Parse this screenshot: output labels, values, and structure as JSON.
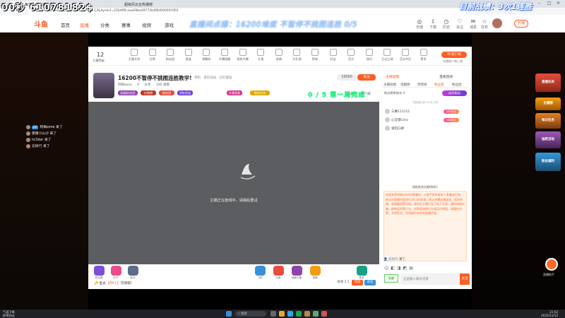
{
  "overlay": {
    "left_counter": "00秒 61078182$",
    "right_stats": "目前战绩：3次1连胜",
    "marquee": "直播间点播：16200难度 不暂停不挑图连胜 0/5",
    "score": "0 / 5 第一局完成"
  },
  "browser": {
    "tab_active": "斗鱼 - 每个人的直播平台",
    "tab_second": "超级风云台热播榜",
    "url": "https://www.douyu.com/topic/zhx?rid=12&dyshid=22b4ff8-aaa09ba49772b4f8d69000l1f01"
  },
  "site": {
    "logo": "斗鱼",
    "nav": [
      "首页",
      "直播",
      "分类",
      "赛事",
      "视频",
      "游戏"
    ],
    "icons": [
      {
        "icon": "globe-icon",
        "label": "无缝"
      },
      {
        "icon": "download-icon",
        "label": "下载"
      },
      {
        "icon": "history-icon",
        "label": "历史"
      },
      {
        "icon": "heart-icon",
        "label": "关注"
      },
      {
        "icon": "mail-icon",
        "label": "消息"
      },
      {
        "icon": "star-icon",
        "label": "任务"
      }
    ],
    "start_live": "开播"
  },
  "category_bar": {
    "level": "12",
    "level_sub": "主播等级",
    "items": [
      "主播开关",
      "月榜",
      "粉丝团",
      "贵族",
      "弹幕机",
      "开播提醒",
      "贵族专属",
      "礼物",
      "表情",
      "大礼物",
      "更新",
      "好友",
      "官方",
      "快讯",
      "互动工具",
      "活动专区",
      "更多"
    ],
    "pc_button": "PC客户端",
    "pc_sub": "去播客户端上播"
  },
  "anchor": {
    "title": "16200不暂停不挑图连胜教学!",
    "tags": "单机 · 冒险竞技 · 记忆图鉴",
    "name": "阿梅zone",
    "heat": "9",
    "sharing": "分享",
    "viewers": "330 观看",
    "badges": [
      "超级粉丝团",
      "礼物榜",
      "粉丝团",
      "领取奖励",
      "开通贵族",
      "我的任务"
    ],
    "follow_count": "19090",
    "follow": "关注",
    "share": "分享",
    "client": "客户端"
  },
  "video": {
    "message": "主播正在连线中，请稍后重试"
  },
  "gifts": [
    {
      "label": "荧光棒",
      "color": "#7c4fd8"
    },
    {
      "label": "办卡",
      "color": "#e84c8a"
    },
    {
      "label": "荧光",
      "color": "#5d6b8c"
    },
    {
      "label": "飞机",
      "color": "#3a8fd9"
    },
    {
      "label": "火箭",
      "color": "#e74c3c"
    },
    {
      "label": "超级火箭",
      "color": "#8e44ad"
    },
    {
      "label": "宝箱",
      "color": "#f39c12"
    },
    {
      "label": "更多",
      "color": "#16a085"
    }
  ],
  "bottom": {
    "fish_text": "鱼丸",
    "fish_value": "【89个】",
    "fish_tail": "可领取!",
    "weekly": "本周 2.1",
    "recharge": "充值",
    "backpack": "背包"
  },
  "rcol": {
    "tabs": [
      "主播投稿",
      "直播回顾"
    ],
    "subtabs": [
      "主播投稿",
      "话题榜",
      "贵宾榜",
      "粉丝团",
      "粉丝团"
    ],
    "fan_rank": "粉丝榜单排名 0",
    "fan_btn": "成为粉丝",
    "fan_hint": "贡献值达到100可上榜",
    "fans": [
      {
        "name": "三赛111111",
        "tag": "LV5粉丝"
      },
      {
        "name": "心灵澳Cero",
        "tag": "LV4粉丝"
      },
      {
        "name": "请您口碑",
        "tag": ""
      }
    ],
    "member_tip": "按照贵宾贡献榜排行",
    "notice": "欢迎来到阿梅zone的直播间。斗鱼严禁未成年人直播或打赏。依法对直播内容进行24小时巡查，禁止传播封建迷信、低俗色情、吸烟酗酒等内容。请勿在主播引导下私下交易，谨防网络诈骗、刷单返利等行为。如发现违规行为请及时举报，请理性消费、文明发言，共同维护良好的直播环境。",
    "chat_user": "云财行",
    "chat_text": "来了",
    "input_placeholder": "这里输入聊天内容",
    "send": "发送",
    "inbox": "私聊"
  },
  "left_chat": [
    {
      "level": "LV",
      "user": "阿梅zone",
      "text": "来了"
    },
    {
      "level": "",
      "user": "康康小山沙",
      "text": "来了"
    },
    {
      "level": "",
      "user": "lic3dar",
      "text": "来了"
    },
    {
      "level": "",
      "user": "云财行",
      "text": "来了"
    }
  ],
  "promos": [
    {
      "text": "直播任务",
      "color": "#c0392b"
    },
    {
      "text": "主播榜",
      "color": "#d35400"
    },
    {
      "text": "每日任务",
      "color": "#e67e22"
    },
    {
      "text": "抽奖活动",
      "color": "#8e44ad"
    },
    {
      "text": "粉丝福利",
      "color": "#2980b9"
    }
  ],
  "float_label": "直播助手",
  "taskbar": {
    "weather1": "气温下降",
    "weather2": "即将到达",
    "search": "搜索",
    "time": "21:02",
    "date": "2025/11/12"
  }
}
